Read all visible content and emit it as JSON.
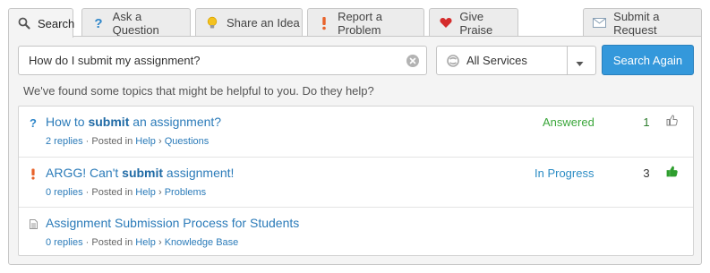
{
  "tabs": [
    {
      "label": "Search",
      "icon": "search-icon",
      "active": true
    },
    {
      "label": "Ask a Question",
      "icon": "question-icon"
    },
    {
      "label": "Share an Idea",
      "icon": "lightbulb-icon"
    },
    {
      "label": "Report a Problem",
      "icon": "exclamation-icon"
    },
    {
      "label": "Give Praise",
      "icon": "heart-icon"
    },
    {
      "label": "Submit a Request",
      "icon": "envelope-icon"
    }
  ],
  "search": {
    "value": "How do I submit my assignment?",
    "clear_icon": "clear-icon"
  },
  "services": {
    "selected": "All Services",
    "icon": "services-icon"
  },
  "search_again_label": "Search Again",
  "helper_text": "We've found some topics that might be helpful to you. Do they help?",
  "results": [
    {
      "type_icon": "question-icon",
      "title_pre": "How to ",
      "title_bold": "submit",
      "title_post": " an assignment?",
      "replies": "2 replies",
      "posted_in": "Posted in",
      "category": "Help",
      "separator": "›",
      "subcategory": "Questions",
      "status": "Answered",
      "status_color": "#3aa63a",
      "count": "1",
      "count_color": "#2f7d2f",
      "thumb_filled": false
    },
    {
      "type_icon": "exclamation-icon",
      "title_pre": "ARGG! Can't ",
      "title_bold": "submit",
      "title_post": " assignment!",
      "replies": "0 replies",
      "posted_in": "Posted in",
      "category": "Help",
      "separator": "›",
      "subcategory": "Problems",
      "status": "In Progress",
      "status_color": "#2b8cc4",
      "count": "3",
      "count_color": "#333333",
      "thumb_filled": true
    },
    {
      "type_icon": "document-icon",
      "title_pre": "Assignment Submission Process for Students",
      "title_bold": "",
      "title_post": "",
      "replies": "0 replies",
      "posted_in": "Posted in",
      "category": "Help",
      "separator": "›",
      "subcategory": "Knowledge Base",
      "status": "",
      "count": "",
      "thumb_filled": null
    }
  ],
  "colors": {
    "accent": "#3498db",
    "link": "#2b7bb9",
    "answered": "#3aa63a",
    "in_progress": "#2b8cc4",
    "thumb_up": "#2e9e2e"
  }
}
